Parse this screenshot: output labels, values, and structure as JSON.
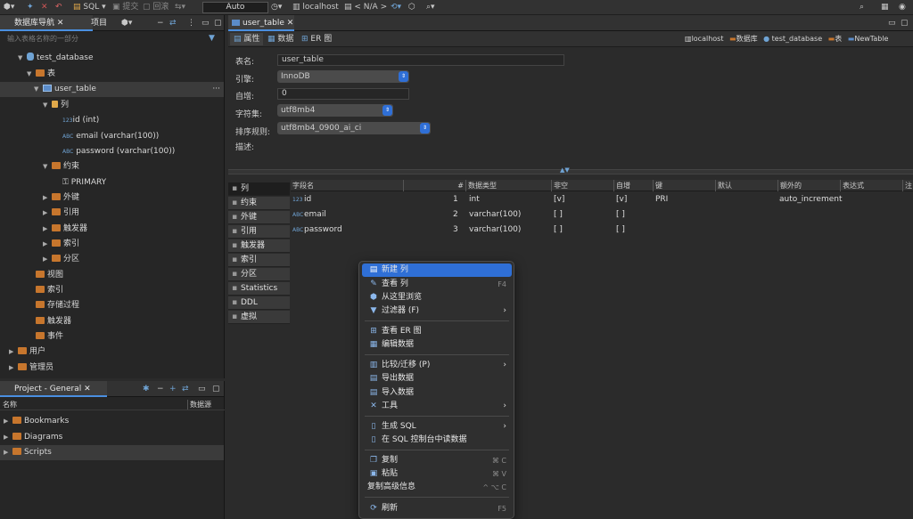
{
  "toolbar": {
    "sql_label": "SQL",
    "commit_label": "提交",
    "rollback_label": "回滚",
    "mode_value": "Auto",
    "host_label": "localhost",
    "schema_label": "< N/A >"
  },
  "nav": {
    "tab_db": "数据库导航",
    "tab_project": "项目",
    "filter_placeholder": "输入表格名称的一部分",
    "tree": {
      "db": "test_database",
      "tables": "表",
      "table": "user_table",
      "columns": "列",
      "col_id": "id (int)",
      "col_email": "email (varchar(100))",
      "col_password": "password (varchar(100))",
      "constraints": "约束",
      "primary": "PRIMARY",
      "fk": "外键",
      "refs": "引用",
      "triggers": "触发器",
      "indexes": "索引",
      "partitions": "分区",
      "views": "视图",
      "idx": "索引",
      "procs": "存储过程",
      "trig": "触发器",
      "events": "事件",
      "users": "用户",
      "admin": "管理员"
    }
  },
  "project": {
    "title": "Project - General",
    "col_name": "名称",
    "col_source": "数据源",
    "items": [
      "Bookmarks",
      "Diagrams",
      "Scripts"
    ]
  },
  "editor": {
    "tab": "user_table",
    "sub_props": "属性",
    "sub_data": "数据",
    "sub_er": "ER 图",
    "crumbs": [
      "localhost",
      "数据库",
      "test_database",
      "表",
      "NewTable"
    ],
    "labels": {
      "name": "表名:",
      "engine": "引擎:",
      "autoinc": "自增:",
      "charset": "字符集:",
      "collation": "排序规则:",
      "desc": "描述:"
    },
    "values": {
      "name": "user_table",
      "engine": "InnoDB",
      "autoinc": "0",
      "charset": "utf8mb4",
      "collation": "utf8mb4_0900_ai_ci"
    }
  },
  "sidetabs": [
    "列",
    "约束",
    "外键",
    "引用",
    "触发器",
    "索引",
    "分区",
    "Statistics",
    "DDL",
    "虚拟"
  ],
  "grid": {
    "headers": [
      "字段名",
      "#",
      "数据类型",
      "非空",
      "自增",
      "键",
      "默认",
      "额外的",
      "表达式",
      "注"
    ],
    "rows": [
      {
        "name": "id",
        "num": "1",
        "type": "int",
        "notnull": "[v]",
        "ai": "[v]",
        "key": "PRI",
        "extra": "auto_increment"
      },
      {
        "name": "email",
        "num": "2",
        "type": "varchar(100)",
        "notnull": "[ ]",
        "ai": "[ ]",
        "key": "",
        "extra": ""
      },
      {
        "name": "password",
        "num": "3",
        "type": "varchar(100)",
        "notnull": "[ ]",
        "ai": "[ ]",
        "key": "",
        "extra": ""
      }
    ]
  },
  "menu": {
    "new_col": "新建 列",
    "view_col": "查看 列",
    "view_col_sc": "F4",
    "browse": "从这里浏览",
    "filter": "过滤器 (F)",
    "view_er": "查看 ER 图",
    "edit_data": "编辑数据",
    "compare": "比较/迁移 (P)",
    "export": "导出数据",
    "import": "导入数据",
    "tools": "工具",
    "gen_sql": "生成 SQL",
    "read_sql": "在 SQL 控制台中读数据",
    "copy": "复制",
    "copy_sc": "⌘ C",
    "paste": "粘贴",
    "paste_sc": "⌘ V",
    "copy_adv": "复制高级信息",
    "copy_adv_sc": "^ ⌥ C",
    "refresh": "刷新",
    "refresh_sc": "F5"
  },
  "colors": {
    "accent": "#2f6fd6",
    "folder": "#c7762d"
  }
}
